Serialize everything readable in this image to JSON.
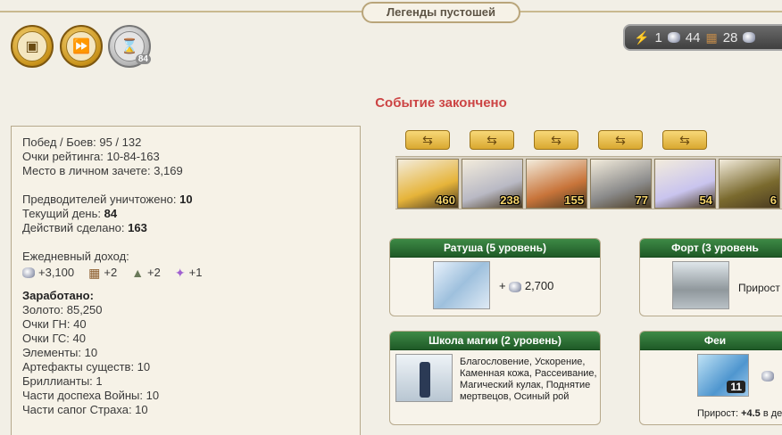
{
  "header": {
    "title": "Легенды пустошей"
  },
  "top_buttons": [
    {
      "icon": "map-scroll-icon"
    },
    {
      "icon": "fast-forward-icon"
    },
    {
      "icon": "hourglass-icon",
      "count": "84"
    }
  ],
  "resources": {
    "energy": "1",
    "crystals": "44",
    "planks": "28"
  },
  "event": {
    "status": "Событие закончено"
  },
  "stats": {
    "wins_battles": "Побед / Боев: 95 / 132",
    "rating_points": "Очки рейтинга: 10-84-163",
    "place": "Место в личном зачете: 3,169",
    "leaders_label": "Предводителей уничтожено: ",
    "leaders_value": "10",
    "day_label": "Текущий день: ",
    "day_value": "84",
    "actions_label": "Действий сделано: ",
    "actions_value": "163",
    "income_title": "Ежедневный доход:",
    "income": [
      "+3,100",
      "+2",
      "+2",
      "+1"
    ],
    "earned_title": "Заработано:",
    "earned": [
      "Золото: 85,250",
      "Очки ГН: 40",
      "Очки ГС: 40",
      "Элементы: 10",
      "Артефакты существ: 10",
      "Бриллианты: 1",
      "Части доспеха Войны: 10",
      "Части сапог Страха: 10"
    ]
  },
  "heroes": [
    {
      "count": "460",
      "color": "#e6b43a"
    },
    {
      "count": "238",
      "color": "#b9b9c4"
    },
    {
      "count": "155",
      "color": "#c8743a"
    },
    {
      "count": "77",
      "color": "#8a8a8a"
    },
    {
      "count": "54",
      "color": "#c9c4ee"
    },
    {
      "count": "6",
      "color": "#7a6a2e"
    }
  ],
  "cards": {
    "townhall": {
      "title": "Ратуша (5 уровень)",
      "plus": "+",
      "value": "2,700"
    },
    "fort": {
      "title": "Форт (3 уровень",
      "growth": "Прирост"
    },
    "magic_school": {
      "title": "Школа магии (2 уровень)",
      "spells": "Благословение, Ускорение, Каменная кожа, Рассеивание, Магический кулак, Поднятие мертвецов, Осиный рой"
    },
    "fairies": {
      "title": "Феи",
      "count": "11",
      "growth_label": "Прирост:",
      "growth_value": "+4.5",
      "growth_suffix": "в де"
    }
  },
  "colors": {
    "accent_red": "#cc4444",
    "header_green": "#2f7a38",
    "gold": "#d9a830"
  }
}
